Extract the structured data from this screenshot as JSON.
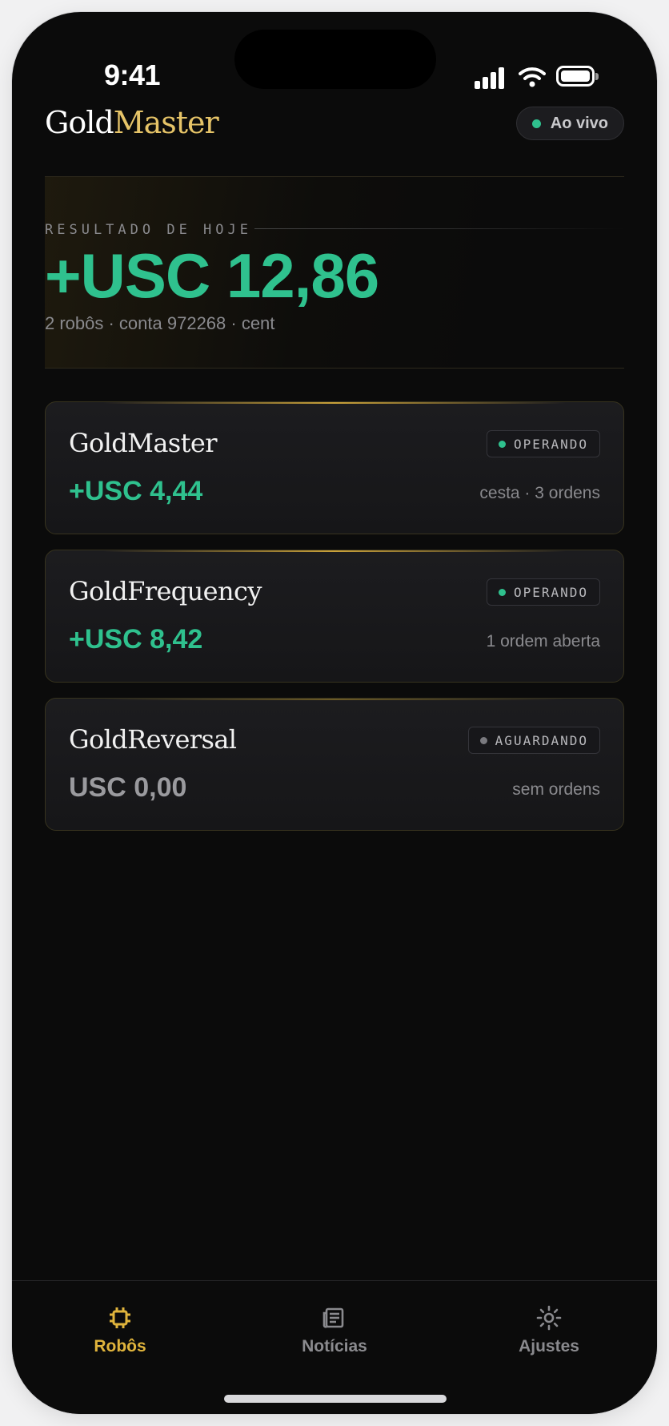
{
  "status_bar": {
    "time": "9:41"
  },
  "header": {
    "logo_primary": "Gold",
    "logo_accent": "Master",
    "live_label": "Ao vivo"
  },
  "hero": {
    "label": "RESULTADO DE HOJE",
    "value": "+USC 12,86",
    "subtitle": "2 robôs · conta 972268 · cent"
  },
  "robots": [
    {
      "name": "GoldMaster",
      "status": "OPERANDO",
      "status_color": "#2fc18e",
      "value": "+USC 4,44",
      "value_color": "#2fc18e",
      "meta": "cesta · 3 ordens"
    },
    {
      "name": "GoldFrequency",
      "status": "OPERANDO",
      "status_color": "#2fc18e",
      "value": "+USC 8,42",
      "value_color": "#2fc18e",
      "meta": "1 ordem aberta"
    },
    {
      "name": "GoldReversal",
      "status": "AGUARDANDO",
      "status_color": "#7a7a7f",
      "value": "USC 0,00",
      "value_color": "#9a9a9e",
      "meta": "sem ordens"
    }
  ],
  "tabs": [
    {
      "label": "Robôs",
      "icon": "chip-icon",
      "active": true
    },
    {
      "label": "Notícias",
      "icon": "newspaper-icon",
      "active": false
    },
    {
      "label": "Ajustes",
      "icon": "sun-settings-icon",
      "active": false
    }
  ],
  "colors": {
    "accent_gold": "#e6c468",
    "tab_active": "#e0b43c",
    "tab_inactive": "#8a8a8e",
    "positive": "#2fc18e",
    "background": "#0b0b0b"
  }
}
